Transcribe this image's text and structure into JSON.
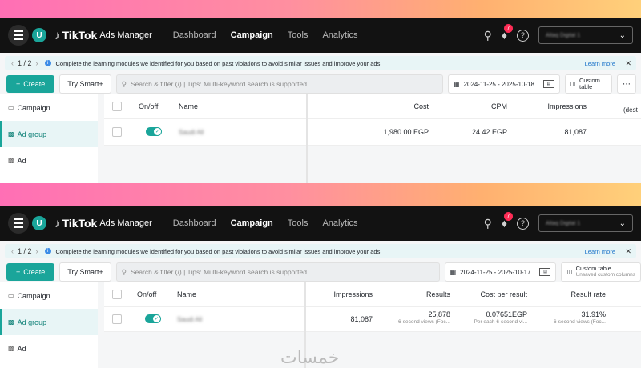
{
  "nav": {
    "avatar_letter": "U",
    "brand": "TikTok",
    "brand_sub": "Ads Manager",
    "links": [
      "Dashboard",
      "Campaign",
      "Tools",
      "Analytics"
    ],
    "active_link": "Campaign",
    "notif_count": "7",
    "account_name": "Altaq Digital 1"
  },
  "notice": {
    "pager": "1 / 2",
    "text": "Complete the learning modules we identified for you based on past violations to avoid similar issues and improve your ads.",
    "learn_more": "Learn more"
  },
  "toolbar": {
    "create_label": "Create",
    "smart_label": "Try Smart+",
    "search_placeholder": "Search & filter (/) | Tips: Multi-keyword search is supported",
    "custom_table_label": "Custom table",
    "custom_table_sub": "Unsaved custom columns"
  },
  "sidebar": {
    "items": [
      "Campaign",
      "Ad group",
      "Ad"
    ],
    "active": "Ad group"
  },
  "panel1": {
    "date_range": "2024-11-25 - 2025-10-18",
    "headers": {
      "onoff": "On/off",
      "name": "Name",
      "cost": "Cost",
      "cpm": "CPM",
      "impressions": "Impressions",
      "dest": "(dest"
    },
    "row": {
      "name": "Saudi All",
      "cost": "1,980.00 EGP",
      "cpm": "24.42 EGP",
      "impressions": "81,087"
    }
  },
  "panel2": {
    "date_range": "2024-11-25 - 2025-10-17",
    "headers": {
      "onoff": "On/off",
      "name": "Name",
      "impressions": "Impressions",
      "results": "Results",
      "cost_per_result": "Cost per result",
      "result_rate": "Result rate"
    },
    "row": {
      "name": "Saudi All",
      "impressions": "81,087",
      "results": "25,878",
      "results_sub": "6-second views (Foc...",
      "cost_per_result": "0.07651EGP",
      "cost_per_result_sub": "Per each 6-second vi...",
      "result_rate": "31.91%",
      "result_rate_sub": "6-second views (Foc..."
    }
  },
  "watermark": "خمسات",
  "colors": {
    "accent": "#1aa59a",
    "nav_bg": "#121212",
    "notice_bg": "#e8f5f6",
    "badge": "#fe2c55"
  }
}
